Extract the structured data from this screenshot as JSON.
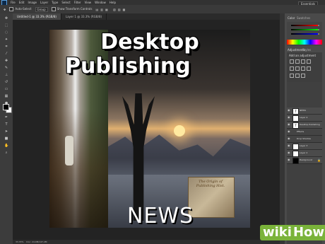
{
  "app": {
    "menu": [
      "File",
      "Edit",
      "Image",
      "Layer",
      "Type",
      "Select",
      "Filter",
      "View",
      "Window",
      "Help"
    ],
    "workspace": "Essentials"
  },
  "options_bar": {
    "auto_select": "Auto-Select",
    "auto_select_target": "Group",
    "transform_controls": "Show Transform Controls"
  },
  "tabs": [
    {
      "label": "Untitled-1 @ 33.3% (RGB/8)"
    },
    {
      "label": "Layer 1 @ 33.3% (RGB/8)"
    }
  ],
  "document": {
    "title_line1": "Desktop",
    "title_line2": "Publishing",
    "footer_word": "NEWS",
    "parchment_text": "The Origin of Publishing Hist."
  },
  "panels": {
    "color_tab": "Color",
    "swatches_tab": "Swatches",
    "adjustments_tab": "Adjustments",
    "styles_tab": "Styles",
    "adjustments_hint": "Add an adjustment",
    "layers_tab": "Layers",
    "channels_tab": "Channels",
    "paths_tab": "Paths",
    "color_values": {
      "r": "0",
      "g": "0",
      "b": "0"
    }
  },
  "layers": [
    {
      "name": "NEWS",
      "kind": "text"
    },
    {
      "name": "Layer 4",
      "kind": "image"
    },
    {
      "name": "Desktop Publishing",
      "kind": "text"
    },
    {
      "name": "Effects",
      "kind": "effect"
    },
    {
      "name": "Drop Shadow",
      "kind": "effect"
    },
    {
      "name": "Layer 3",
      "kind": "image"
    },
    {
      "name": "Layer 2",
      "kind": "image"
    },
    {
      "name": "Background",
      "kind": "background"
    }
  ],
  "status": {
    "zoom": "33.33%",
    "doc": "Doc: 24.9M/147.2M"
  },
  "watermark": {
    "wiki": "wiki",
    "how": "How"
  }
}
